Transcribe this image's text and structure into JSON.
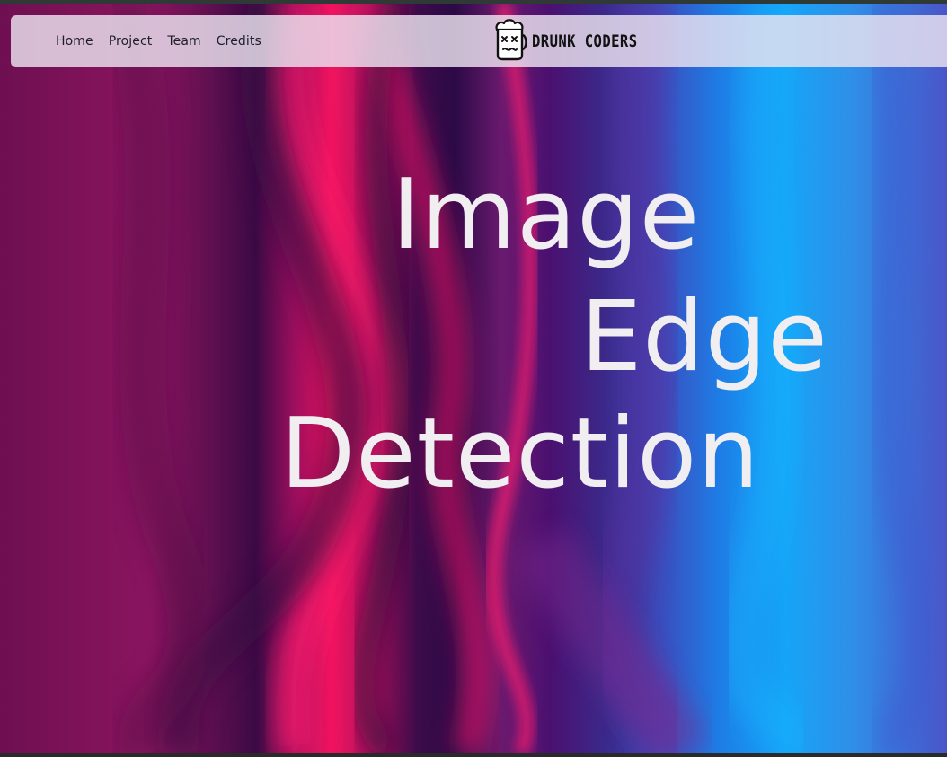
{
  "nav": {
    "links": [
      "Home",
      "Project",
      "Team",
      "Credits"
    ],
    "logo_text": "DRUNK CODERS",
    "logo_icon": "drunk-beer-mug-icon"
  },
  "hero": {
    "title_lines": [
      "Image",
      "Edge",
      "Detection"
    ]
  },
  "colors": {
    "text": "#f1eef2",
    "navbar_bg": "#ece4f0",
    "magenta": "#f2145f",
    "purple": "#3b0a45",
    "blue": "#16a4f7"
  }
}
